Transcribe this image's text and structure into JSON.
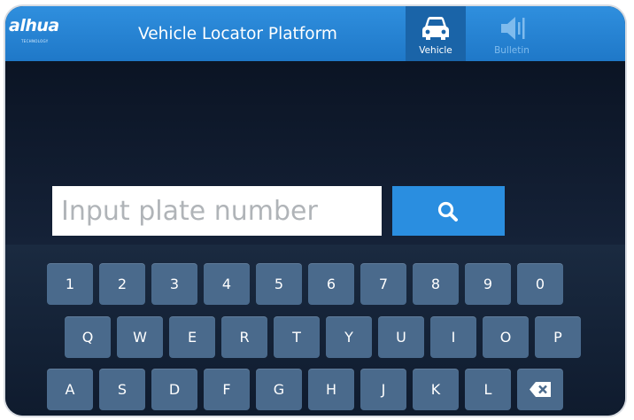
{
  "header": {
    "logo": "alhua",
    "logo_sub": "TECHNOLOGY",
    "title": "Vehicle Locator Platform",
    "tabs": [
      {
        "label": "Vehicle",
        "icon": "car-icon",
        "active": true
      },
      {
        "label": "Bulletin",
        "icon": "speaker-icon",
        "active": false
      }
    ]
  },
  "search": {
    "placeholder": "Input plate number",
    "value": "",
    "button_icon": "search-icon"
  },
  "keyboard": {
    "rows": [
      [
        "1",
        "2",
        "3",
        "4",
        "5",
        "6",
        "7",
        "8",
        "9",
        "0"
      ],
      [
        "Q",
        "W",
        "E",
        "R",
        "T",
        "Y",
        "U",
        "I",
        "O",
        "P"
      ],
      [
        "A",
        "S",
        "D",
        "F",
        "G",
        "H",
        "J",
        "K",
        "L"
      ]
    ],
    "backspace_icon": "backspace-icon"
  },
  "colors": {
    "header_blue": "#2f8fde",
    "active_tab": "#1a64a8",
    "key_bg": "#4a6a8c",
    "background": "#0f1a2b",
    "search_button": "#2a8ee0"
  }
}
